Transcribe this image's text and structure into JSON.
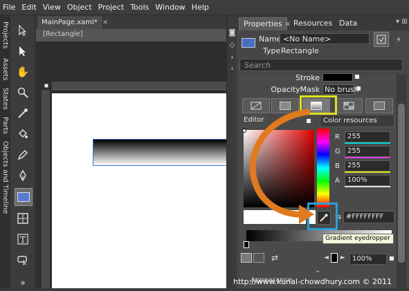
{
  "menu": [
    "File",
    "Edit",
    "View",
    "Object",
    "Project",
    "Tools",
    "Window",
    "Help"
  ],
  "left_tabs": [
    "Projects",
    "Assets",
    "States",
    "Parts",
    "Objects and Timeline"
  ],
  "document": {
    "tab_label": "MainPage.xaml*",
    "breadcrumb": "[Rectangle]"
  },
  "panel_tabs": [
    "Properties",
    "Resources",
    "Data"
  ],
  "properties": {
    "name_label": "Name",
    "name_value": "<No Name>",
    "type_label": "Type",
    "type_value": "Rectangle",
    "search_placeholder": "Search",
    "stroke_label": "Stroke",
    "opacitymask_label": "OpacityMask",
    "opacitymask_value": "No brush",
    "editor_label": "Editor",
    "color_resources_label": "Color resources",
    "channels": [
      {
        "label": "R",
        "value": "255",
        "color": "#00d8d8"
      },
      {
        "label": "G",
        "value": "255",
        "color": "#e040e0"
      },
      {
        "label": "B",
        "value": "255",
        "color": "#e8e820"
      },
      {
        "label": "A",
        "value": "100%",
        "color": "#e0e0e0"
      }
    ],
    "hex_value": "#FFFFFFFF",
    "tooltip": "Gradient eyedropper",
    "zoom_value": "100%",
    "appearance_label": "Appearance"
  },
  "watermark": "http://www.kunal-chowdhury.com © 2011",
  "colors": {
    "highlight_yellow": "#e0e020",
    "highlight_blue": "#2aa0d8",
    "arrow": "#e07a1e",
    "selection": "#3f6bd6"
  }
}
